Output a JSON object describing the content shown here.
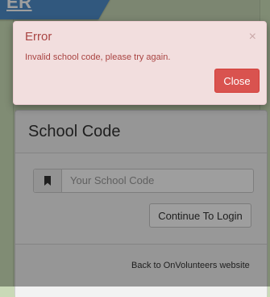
{
  "branding": {
    "ribbon_text": "ER"
  },
  "modal": {
    "title": "Error",
    "close_glyph": "×",
    "message": "Invalid school code, please try again.",
    "close_button": "Close"
  },
  "card": {
    "title": "School Code",
    "input_placeholder": "Your School Code",
    "continue_button": "Continue To Login",
    "back_link": "Back to OnVolunteers website"
  },
  "colors": {
    "error_text": "#a94442",
    "error_bg": "#f2dede",
    "danger_button": "#d9534f",
    "ribbon": "#4f8fcc"
  },
  "icons": {
    "input_addon": "bookmark-icon"
  }
}
